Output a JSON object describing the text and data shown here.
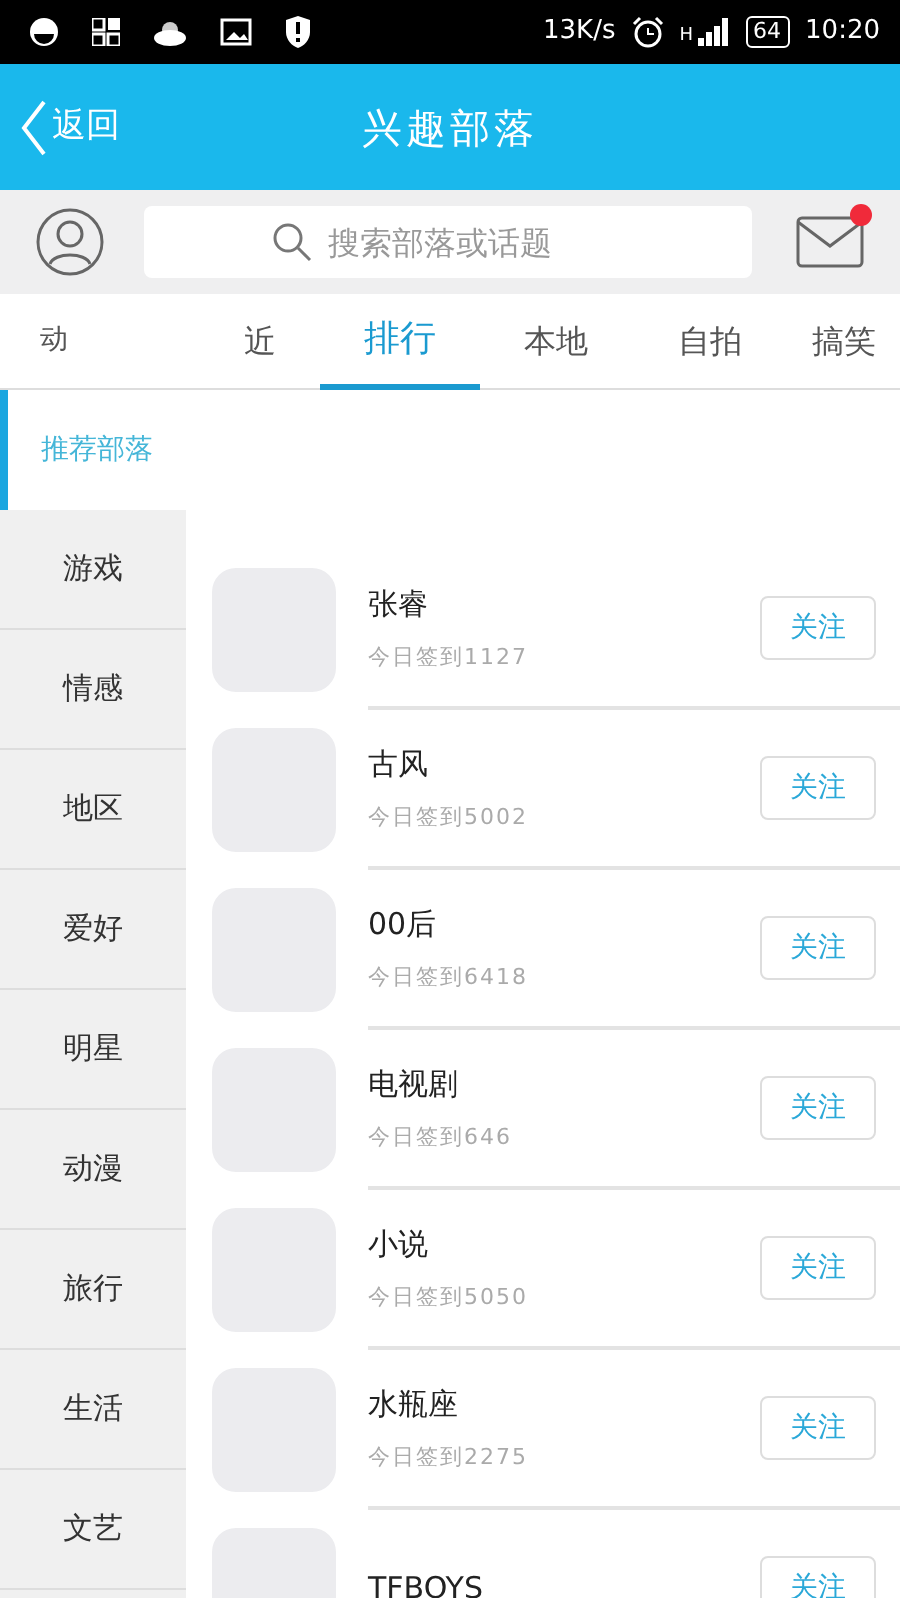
{
  "status_bar": {
    "speed": "13K/s",
    "network": "H",
    "battery": "64",
    "time": "10:20"
  },
  "header": {
    "back": "返回",
    "title": "兴趣部落"
  },
  "search": {
    "placeholder": "搜索部落或话题"
  },
  "mail": {
    "unread": true
  },
  "tabs": [
    {
      "label": "动",
      "selected": false
    },
    {
      "label": "近",
      "selected": false
    },
    {
      "label": "排行",
      "selected": true
    },
    {
      "label": "本地",
      "selected": false
    },
    {
      "label": "自拍",
      "selected": false
    },
    {
      "label": "搞笑",
      "selected": false
    }
  ],
  "sidebar": {
    "items": [
      {
        "label": "推荐部落",
        "selected": true
      },
      {
        "label": "游戏",
        "selected": false
      },
      {
        "label": "情感",
        "selected": false
      },
      {
        "label": "地区",
        "selected": false
      },
      {
        "label": "爱好",
        "selected": false
      },
      {
        "label": "明星",
        "selected": false
      },
      {
        "label": "动漫",
        "selected": false
      },
      {
        "label": "旅行",
        "selected": false
      },
      {
        "label": "生活",
        "selected": false
      },
      {
        "label": "文艺",
        "selected": false
      }
    ]
  },
  "tribes": [
    {
      "name": "张睿",
      "checkin": "今日签到1127",
      "button": "关注"
    },
    {
      "name": "古风",
      "checkin": "今日签到5002",
      "button": "关注"
    },
    {
      "name": "00后",
      "checkin": "今日签到6418",
      "button": "关注"
    },
    {
      "name": "电视剧",
      "checkin": "今日签到646",
      "button": "关注"
    },
    {
      "name": "小说",
      "checkin": "今日签到5050",
      "button": "关注"
    },
    {
      "name": "水瓶座",
      "checkin": "今日签到2275",
      "button": "关注"
    },
    {
      "name": "TFBOYS",
      "button": "关注"
    }
  ]
}
